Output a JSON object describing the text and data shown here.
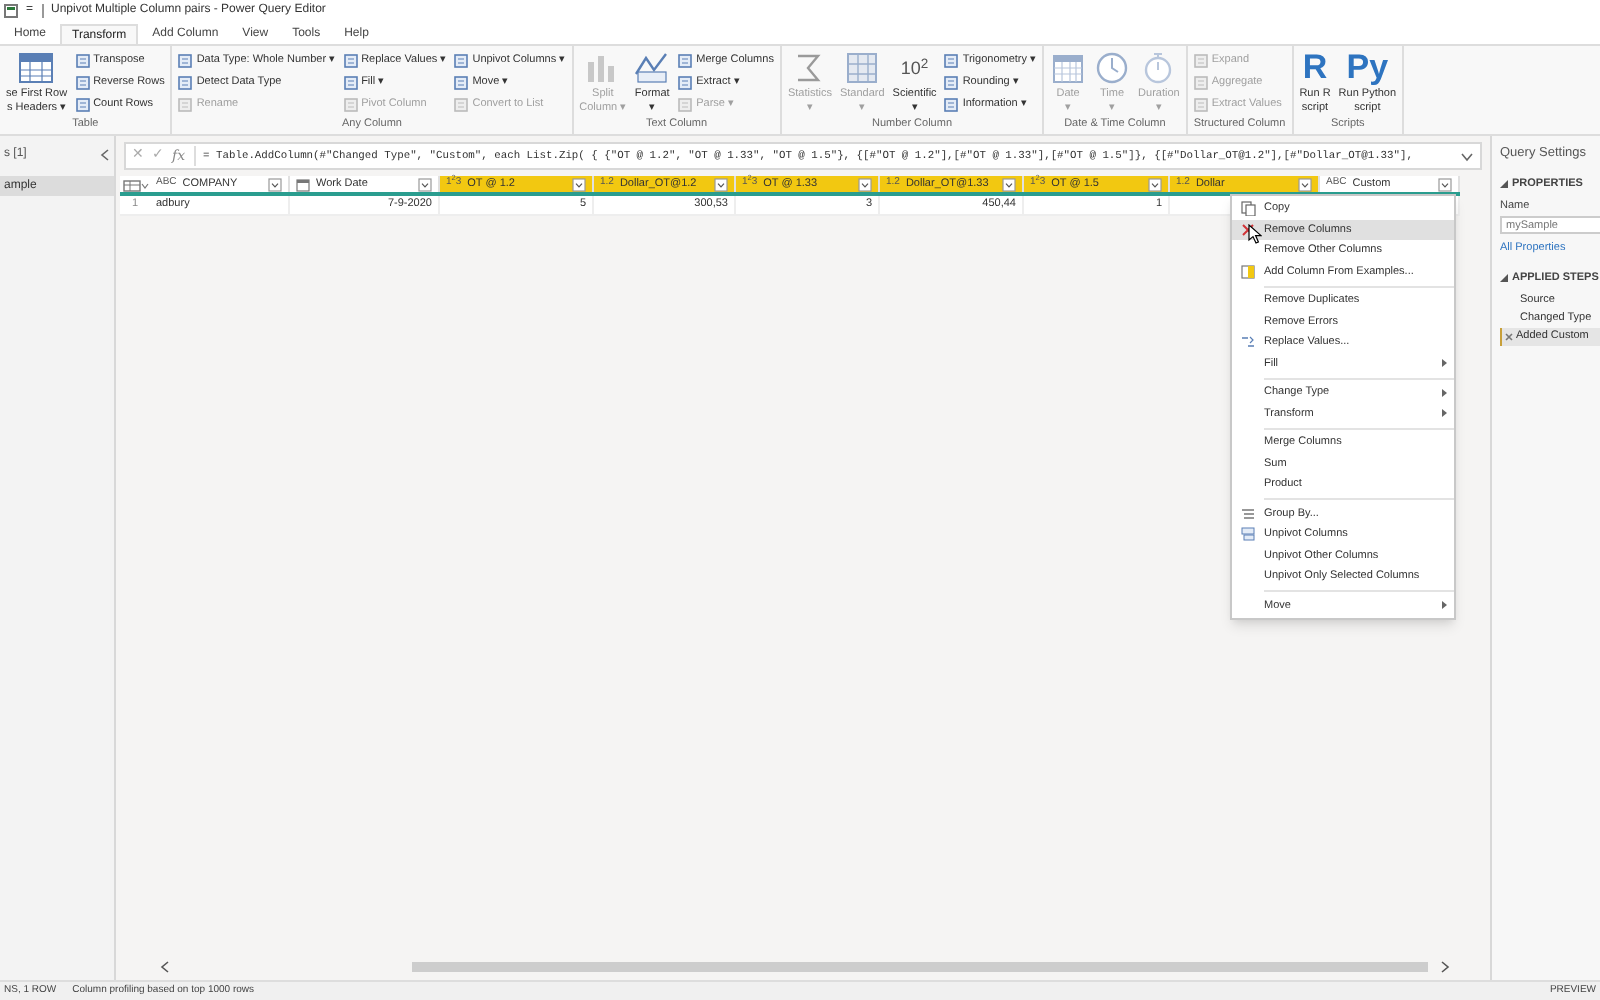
{
  "window": {
    "title": "Unpivot Multiple Column pairs - Power Query Editor",
    "quick_access": "="
  },
  "tabs": [
    {
      "label": "Home",
      "selected": false
    },
    {
      "label": "Transform",
      "selected": true
    },
    {
      "label": "Add Column",
      "selected": false
    },
    {
      "label": "View",
      "selected": false
    },
    {
      "label": "Tools",
      "selected": false
    },
    {
      "label": "Help",
      "selected": false
    }
  ],
  "ribbon": [
    {
      "label": "Table",
      "columns": [
        [
          {
            "kind": "large",
            "label": "se First Row\ns Headers ▾",
            "disabled": false
          }
        ],
        [
          {
            "kind": "small",
            "label": "Transpose",
            "disabled": false
          },
          {
            "kind": "small",
            "label": "Reverse Rows",
            "disabled": false
          },
          {
            "kind": "small",
            "label": "Count Rows",
            "disabled": false
          }
        ]
      ]
    },
    {
      "label": "Any Column",
      "columns": [
        [
          {
            "kind": "small",
            "label": "Data Type: Whole Number ▾",
            "disabled": false
          },
          {
            "kind": "small",
            "label": "Detect Data Type",
            "disabled": false
          },
          {
            "kind": "small",
            "label": "Rename",
            "disabled": true
          }
        ],
        [
          {
            "kind": "small",
            "label": "Replace Values ▾",
            "disabled": false
          },
          {
            "kind": "small",
            "label": "Fill ▾",
            "disabled": false
          },
          {
            "kind": "small",
            "label": "Pivot Column",
            "disabled": true
          }
        ],
        [
          {
            "kind": "small",
            "label": "Unpivot Columns ▾",
            "disabled": false
          },
          {
            "kind": "small",
            "label": "Move ▾",
            "disabled": false
          },
          {
            "kind": "small",
            "label": "Convert to List",
            "disabled": true
          }
        ]
      ]
    },
    {
      "label": "Text Column",
      "columns": [
        [
          {
            "kind": "large",
            "label": "Split\nColumn ▾",
            "disabled": true
          }
        ],
        [
          {
            "kind": "large",
            "label": "Format\n▾",
            "disabled": false
          }
        ],
        [
          {
            "kind": "small",
            "label": "Merge Columns",
            "disabled": false
          },
          {
            "kind": "small",
            "label": "Extract ▾",
            "disabled": false
          },
          {
            "kind": "small",
            "label": "Parse ▾",
            "disabled": true
          }
        ]
      ]
    },
    {
      "label": "Number Column",
      "columns": [
        [
          {
            "kind": "large",
            "label": "Statistics\n▾",
            "disabled": true
          }
        ],
        [
          {
            "kind": "large",
            "label": "Standard\n▾",
            "disabled": true
          }
        ],
        [
          {
            "kind": "symbol",
            "symbol": "10$^{2}$",
            "label": "Scientific\n▾",
            "disabled": false
          }
        ],
        [
          {
            "kind": "small",
            "label": "Trigonometry ▾",
            "disabled": false
          },
          {
            "kind": "small",
            "label": "Rounding ▾",
            "disabled": false
          },
          {
            "kind": "small",
            "label": "Information ▾",
            "disabled": false
          }
        ]
      ]
    },
    {
      "label": "Date & Time Column",
      "columns": [
        [
          {
            "kind": "large",
            "label": "Date\n▾",
            "disabled": true
          }
        ],
        [
          {
            "kind": "large",
            "label": "Time\n▾",
            "disabled": true
          }
        ],
        [
          {
            "kind": "large",
            "label": "Duration\n▾",
            "disabled": true
          }
        ]
      ]
    },
    {
      "label": "Structured Column",
      "columns": [
        [
          {
            "kind": "small",
            "label": "Expand",
            "disabled": true
          },
          {
            "kind": "small",
            "label": "Aggregate",
            "disabled": true
          },
          {
            "kind": "small",
            "label": "Extract Values",
            "disabled": true
          }
        ]
      ]
    },
    {
      "label": "Scripts",
      "columns": [
        [
          {
            "kind": "symbol",
            "symbol": "R",
            "label": "Run R\nscript",
            "disabled": false
          }
        ],
        [
          {
            "kind": "symbol",
            "symbol": "Py",
            "label": "Run Python\nscript",
            "disabled": false
          }
        ]
      ]
    }
  ],
  "queries": {
    "header": "s [1]",
    "items": [
      {
        "label": "ample",
        "selected": true
      }
    ]
  },
  "formula_bar": {
    "cancel": "✕",
    "confirm": "✓",
    "fx": "fx",
    "text": "= Table.AddColumn(#\"Changed Type\", \"Custom\", each List.Zip( { {\"OT @ 1.2\", \"OT @ 1.33\", \"OT @ 1.5\"}, {[#\"OT @ 1.2\"],[#\"OT @ 1.33\"],[#\"OT @ 1.5\"]}, {[#\"Dollar_OT@1.2\"],[#\"Dollar_OT@1.33\"],"
  },
  "table": {
    "columns": [
      {
        "type": "ABC",
        "name": "COMPANY",
        "selected": false
      },
      {
        "name": "Work Date",
        "selected": false
      },
      {
        "type": "1$^{2}$3",
        "name": "OT @ 1.2",
        "selected": true
      },
      {
        "type": "1.2",
        "name": "Dollar_OT@1.2",
        "selected": true
      },
      {
        "type": "1$^{2}$3",
        "name": "OT @ 1.33",
        "selected": true
      },
      {
        "type": "1.2",
        "name": "Dollar_OT@1.33",
        "selected": true
      },
      {
        "type": "1$^{2}$3",
        "name": "OT @ 1.5",
        "selected": true
      },
      {
        "type": "1.2",
        "name": "Dollar",
        "selected": true
      },
      {
        "type": "ABC",
        "name": "Custom",
        "selected": false
      }
    ],
    "rows": [
      {
        "number": "1",
        "cells": [
          "adbury",
          "7-9-2020",
          "5",
          "300,53",
          "3",
          "450,44",
          "1"
        ]
      }
    ]
  },
  "context_menu": [
    {
      "kind": "item",
      "label": "Copy",
      "selected": false
    },
    {
      "kind": "item",
      "label": "Remove Columns",
      "selected": true
    },
    {
      "kind": "item",
      "label": "Remove Other Columns",
      "selected": false
    },
    {
      "kind": "item",
      "label": "Add Column From Examples...",
      "selected": false
    },
    {
      "kind": "separator"
    },
    {
      "kind": "item",
      "label": "Remove Duplicates",
      "selected": false
    },
    {
      "kind": "item",
      "label": "Remove Errors",
      "selected": false
    },
    {
      "kind": "item",
      "label": "Replace Values...",
      "selected": false
    },
    {
      "kind": "submenu",
      "label": "Fill",
      "selected": false
    },
    {
      "kind": "separator"
    },
    {
      "kind": "submenu",
      "label": "Change Type",
      "selected": false
    },
    {
      "kind": "submenu",
      "label": "Transform",
      "selected": false
    },
    {
      "kind": "separator"
    },
    {
      "kind": "item",
      "label": "Merge Columns",
      "selected": false
    },
    {
      "kind": "item",
      "label": "Sum",
      "selected": false
    },
    {
      "kind": "item",
      "label": "Product",
      "selected": false
    },
    {
      "kind": "separator"
    },
    {
      "kind": "item",
      "label": "Group By...",
      "selected": false
    },
    {
      "kind": "item",
      "label": "Unpivot Columns",
      "selected": false
    },
    {
      "kind": "item",
      "label": "Unpivot Other Columns",
      "selected": false
    },
    {
      "kind": "item",
      "label": "Unpivot Only Selected Columns",
      "selected": false
    },
    {
      "kind": "separator"
    },
    {
      "kind": "submenu",
      "label": "Move",
      "selected": false
    }
  ],
  "query_settings": {
    "title": "Query Settings",
    "properties_heading": "PROPERTIES",
    "name_label": "Name",
    "name_value": "mySample",
    "all_properties": "All Properties",
    "steps_heading": "APPLIED STEPS",
    "steps": [
      {
        "label": "Source",
        "selected": false
      },
      {
        "label": "Changed Type",
        "selected": false
      },
      {
        "label": "Added Custom",
        "selected": true
      }
    ]
  },
  "status_bar": {
    "counts": "NS, 1 ROW",
    "profiling": "Column profiling based on top 1000 rows",
    "mode": "PREVIEW"
  }
}
